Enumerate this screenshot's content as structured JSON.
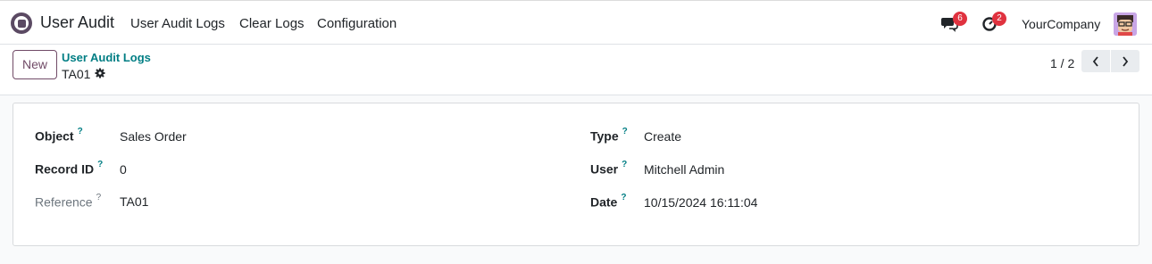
{
  "app": {
    "name": "User Audit",
    "icon": "user-audit-app-icon"
  },
  "menu": {
    "items": [
      {
        "label": "User Audit Logs"
      },
      {
        "label": "Clear Logs"
      },
      {
        "label": "Configuration"
      }
    ]
  },
  "systray": {
    "messages_badge": "6",
    "activities_badge": "2",
    "company": "YourCompany"
  },
  "control": {
    "new_label": "New",
    "breadcrumb_parent": "User Audit Logs",
    "breadcrumb_current": "TA01",
    "pager_value": "1 / 2"
  },
  "form": {
    "left": [
      {
        "label": "Object",
        "help": "?",
        "value": "Sales Order"
      },
      {
        "label": "Record ID",
        "help": "?",
        "value": "0"
      },
      {
        "label": "Reference",
        "help": "?",
        "value": "TA01"
      }
    ],
    "right": [
      {
        "label": "Type",
        "help": "?",
        "value": "Create"
      },
      {
        "label": "User",
        "help": "?",
        "value": "Mitchell Admin"
      },
      {
        "label": "Date",
        "help": "?",
        "value": "10/15/2024 16:11:04"
      }
    ]
  },
  "colors": {
    "brand": "#714b67",
    "link": "#017e84",
    "badge": "#e0323f"
  }
}
